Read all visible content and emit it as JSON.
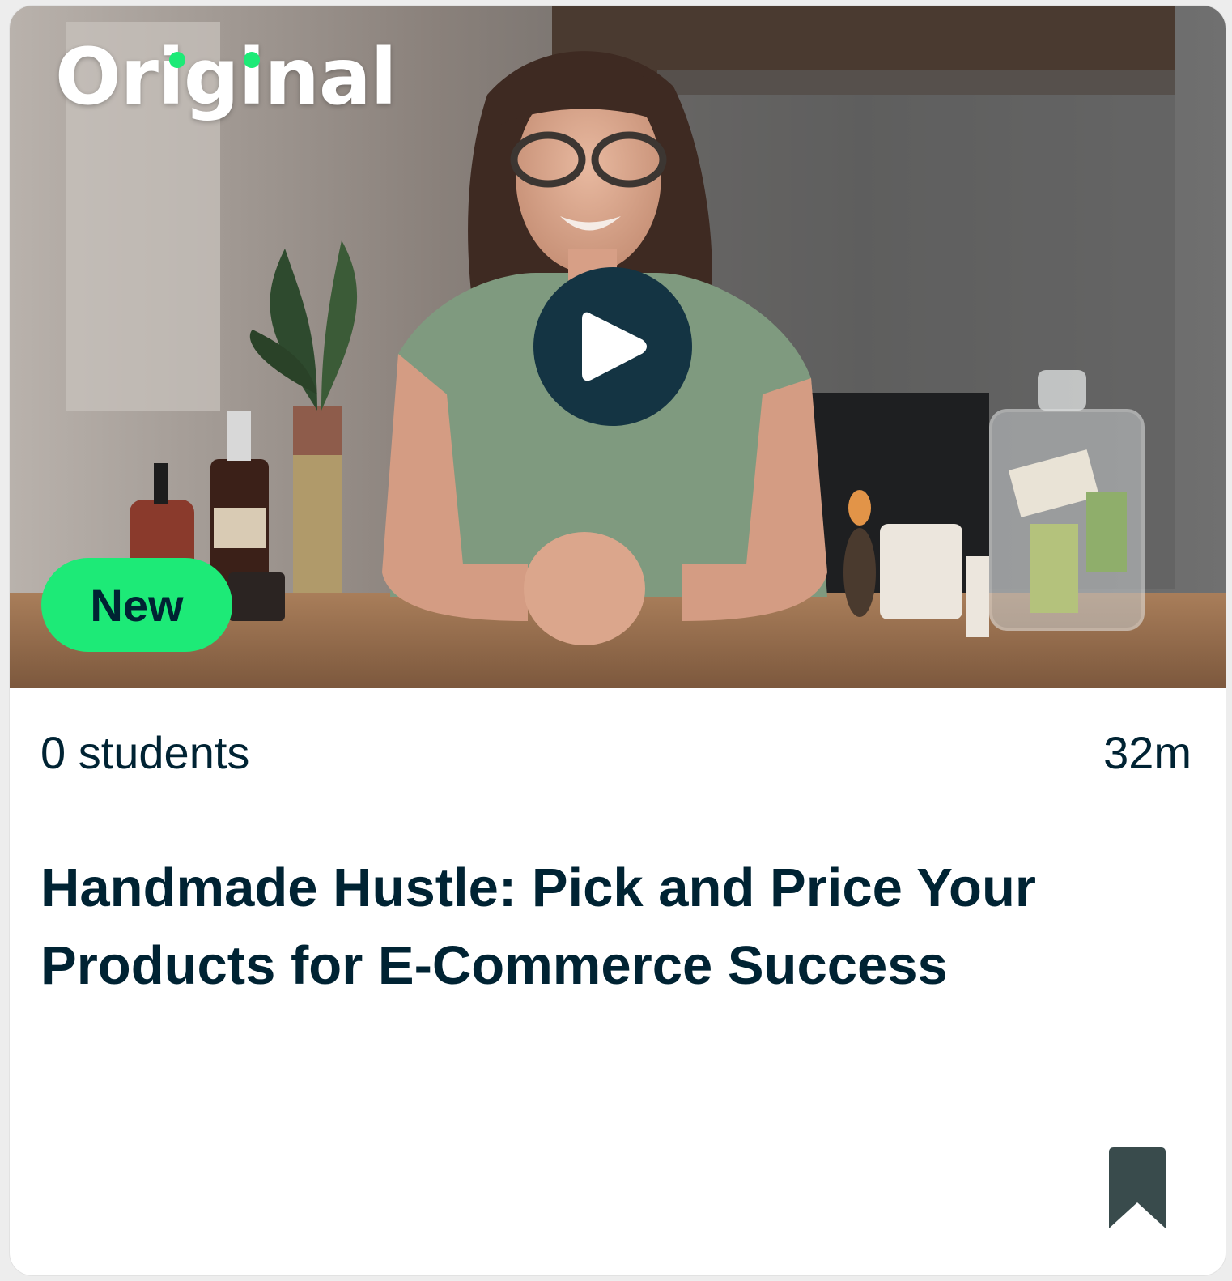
{
  "course_card": {
    "brand_badge": "Original",
    "new_badge": "New",
    "students": "0 students",
    "duration": "32m",
    "title": "Handmade Hustle: Pick and Price Your Products for E-Commerce Success"
  },
  "icons": {
    "play": "play-icon",
    "bookmark": "bookmark-icon"
  },
  "colors": {
    "accent_green": "#1dea77",
    "text_dark": "#002333",
    "play_button_bg": "#143443",
    "bookmark": "#394b4c"
  }
}
